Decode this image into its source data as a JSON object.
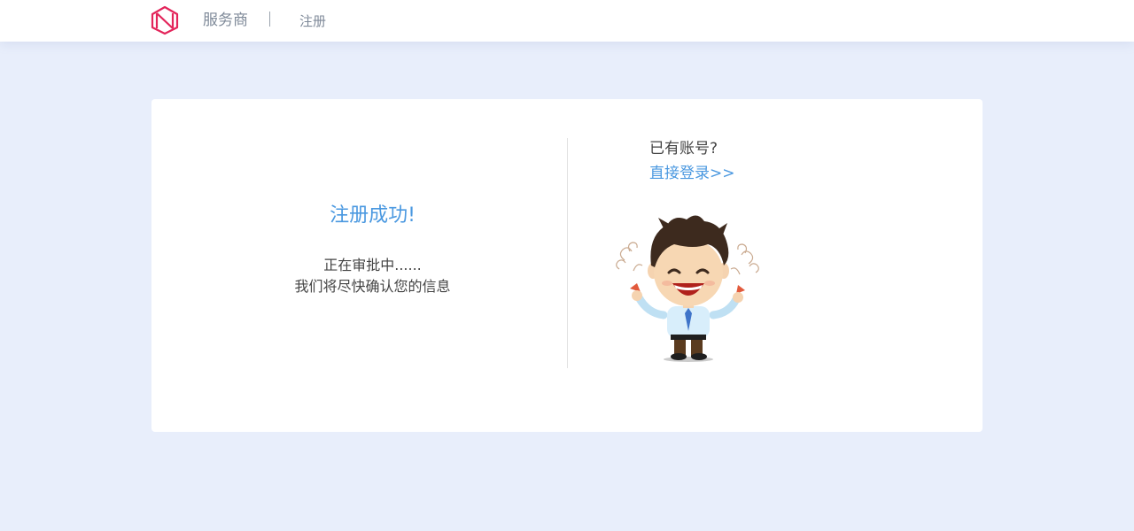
{
  "header": {
    "brand": "服务商",
    "page_name": "注册"
  },
  "left": {
    "title": "注册成功!",
    "line1": "正在审批中......",
    "line2": "我们将尽快确认您的信息"
  },
  "right": {
    "have_account": "已有账号?",
    "login_link": "直接登录>>"
  },
  "colors": {
    "accent": "#4a98e0",
    "logo": "#e3245a",
    "background": "#e8eefb"
  },
  "icons": {
    "logo": "brand-logo-icon",
    "mascot": "celebrating-man-illustration"
  }
}
